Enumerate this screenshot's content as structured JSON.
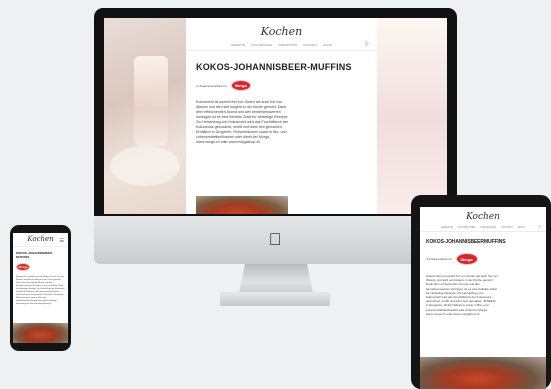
{
  "heading": "...",
  "brand": {
    "super": "",
    "name": "Kochen"
  },
  "nav": [
    "REZEPTE",
    "KOCHBÜCHER",
    "INSPIRATION",
    "KONTAKT",
    "SHOP"
  ],
  "article": {
    "title": "KOKOS-JOHANNISBEER-MUFFINS",
    "title_compact": "KOKOS-JOHANNISBEERMUFFINS",
    "collab_label": "In Zusammenarbeit mit",
    "partner_logo": "Morga",
    "body": "Kokosmehl ist sowohl frei von Gluten als auch frei von Weizen und wird seit langem in der Küche genutzt. Dank dem erfrischenden Aroma und den bemerkenswerten Vorzügen ist es eine beliebte Zutat für vielseitige Rezepte. Zur Herstellung von Kokosmehl wird das Fruchtfleisch der Kokosnuss getrocknet, entölt und dann fein gemahlen. Erhältlich in Drogerien, Reformhäusern sowie in Bio- und Lebensmittelfachhandel oder direkt bei Morga. www.morga.ch oder www.morgashop.ch"
  },
  "icons": {
    "apple": "apple-icon",
    "search": "search-icon",
    "menu": "menu-icon"
  }
}
